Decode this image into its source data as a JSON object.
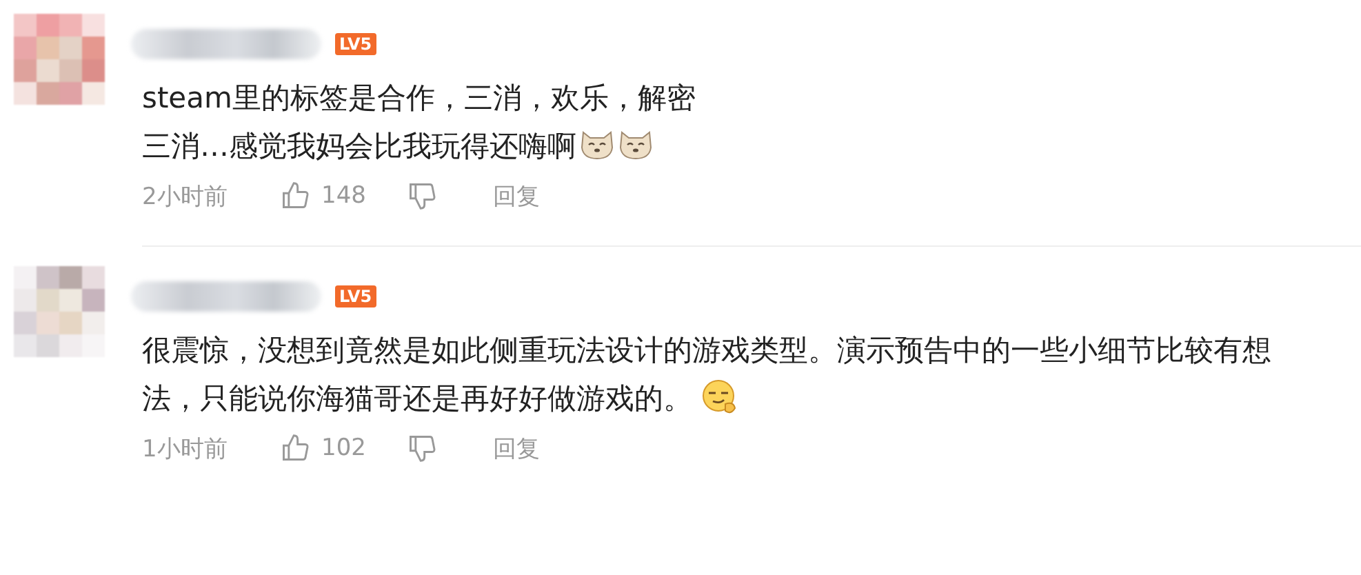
{
  "comments": [
    {
      "level_badge": "LV5",
      "lines": [
        "steam里的标签是合作，三消，欢乐，解密",
        "三消…感觉我妈会比我玩得还嗨啊"
      ],
      "emojis": [
        {
          "kind": "dog"
        },
        {
          "kind": "dog"
        }
      ],
      "time": "2小时前",
      "likes": "148",
      "reply": "回复"
    },
    {
      "level_badge": "LV5",
      "lines": [
        "很震惊，没想到竟然是如此侧重玩法设计的游戏类型。演示预告中的一些小细节比较有想法，只能说你海猫哥还是再好好做游戏的。"
      ],
      "emojis": [
        {
          "kind": "smirk"
        }
      ],
      "time": "1小时前",
      "likes": "102",
      "reply": "回复"
    }
  ]
}
